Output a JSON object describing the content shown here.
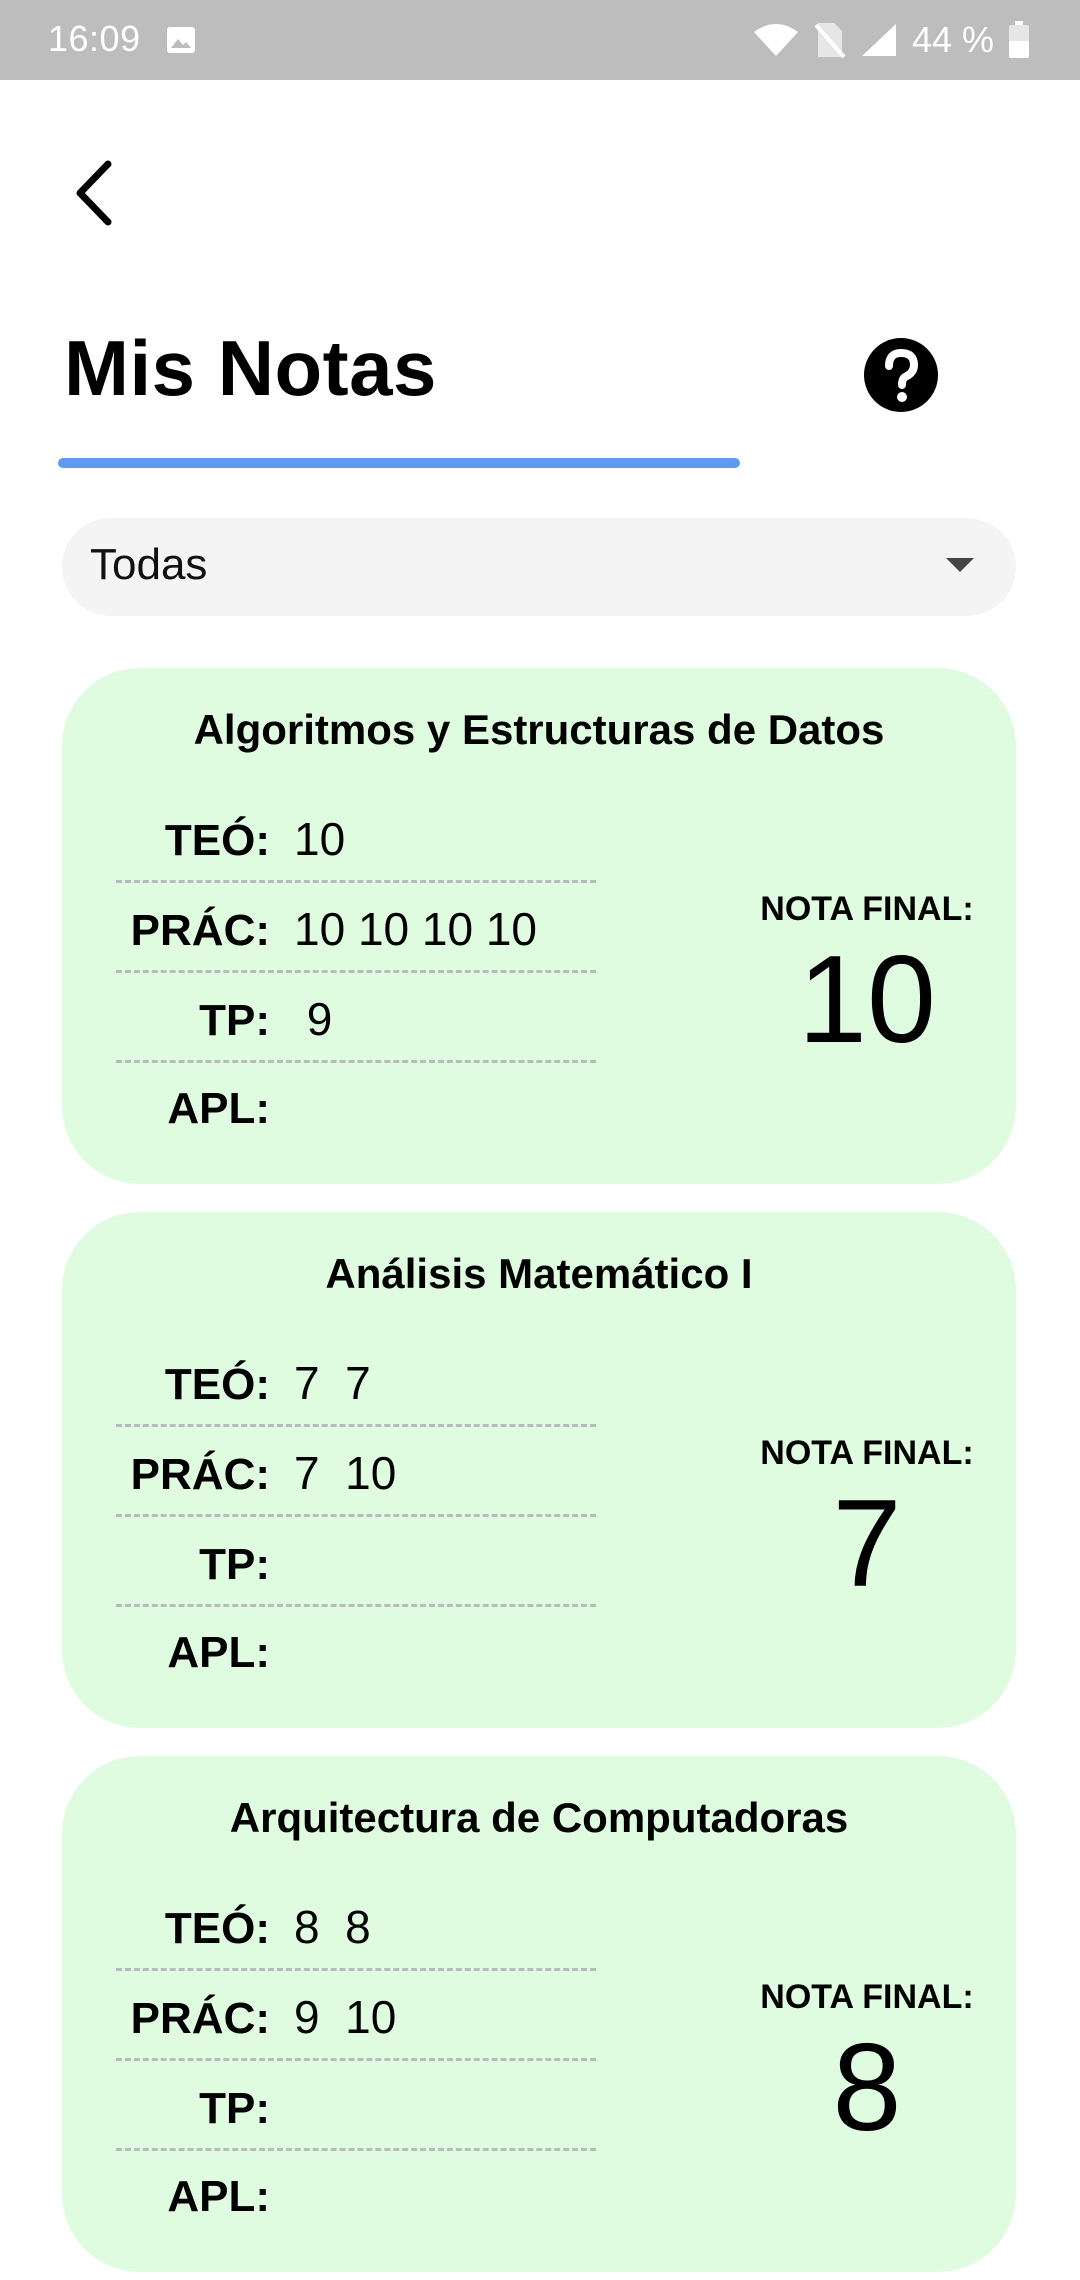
{
  "status_bar": {
    "time": "16:09",
    "battery_text": "44 %",
    "icons": [
      "image-icon",
      "wifi-icon",
      "no-sim-icon",
      "cell-signal-icon",
      "battery-icon"
    ]
  },
  "header": {
    "back_icon": "chevron-left-icon",
    "title": "Mis Notas",
    "help_icon": "question-circle-icon",
    "underline_color": "#5b9cf0"
  },
  "filter": {
    "selected": "Todas"
  },
  "colors": {
    "card_background": "#e0fce0",
    "accent": "#5b9cf0"
  },
  "cards": [
    {
      "title": "Algoritmos y Estructuras de Datos",
      "rows": [
        {
          "label": "TEÓ:",
          "values": "10"
        },
        {
          "label": "PRÁC:",
          "values": "10 10 10 10"
        },
        {
          "label": "TP:",
          "values": " 9"
        },
        {
          "label": "APL:",
          "values": ""
        }
      ],
      "final_label": "NOTA FINAL:",
      "final_grade": "10"
    },
    {
      "title": "Análisis Matemático I",
      "rows": [
        {
          "label": "TEÓ:",
          "values": "7  7"
        },
        {
          "label": "PRÁC:",
          "values": "7  10"
        },
        {
          "label": "TP:",
          "values": ""
        },
        {
          "label": "APL:",
          "values": ""
        }
      ],
      "final_label": "NOTA FINAL:",
      "final_grade": "7"
    },
    {
      "title": "Arquitectura de Computadoras",
      "rows": [
        {
          "label": "TEÓ:",
          "values": "8  8"
        },
        {
          "label": "PRÁC:",
          "values": "9  10"
        },
        {
          "label": "TP:",
          "values": ""
        },
        {
          "label": "APL:",
          "values": ""
        }
      ],
      "final_label": "NOTA FINAL:",
      "final_grade": "8"
    }
  ]
}
